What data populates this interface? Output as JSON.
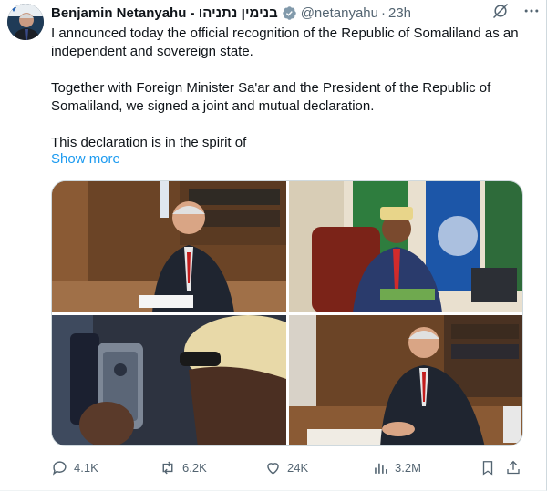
{
  "author": {
    "display_name": "Benjamin Netanyahu - בנימין נתניהו",
    "handle": "@netanyahu",
    "separator": "·",
    "timestamp": "23h",
    "verified_icon": "verified-badge-icon",
    "avatar_icon": "profile-avatar"
  },
  "post": {
    "paragraph_1": "I announced today the official recognition of the Republic of Somaliland as an independent and sovereign state.",
    "paragraph_2": "Together with Foreign Minister Sa'ar and the President of the Republic of Somaliland, we signed a joint and mutual declaration.",
    "paragraph_3": "This declaration is in the spirit of",
    "show_more": "Show more"
  },
  "header_icons": [
    "grok-icon",
    "more-icon"
  ],
  "media": {
    "count": 4
  },
  "actions": {
    "replies": "4.1K",
    "reposts": "6.2K",
    "likes": "24K",
    "views": "3.2M",
    "icons": [
      "reply-icon",
      "repost-icon",
      "like-icon",
      "views-icon",
      "bookmark-icon",
      "share-icon"
    ]
  },
  "colors": {
    "accent": "#1d9bf0",
    "text": "#0f1419",
    "secondary": "#536471",
    "border": "#cfd9de"
  }
}
